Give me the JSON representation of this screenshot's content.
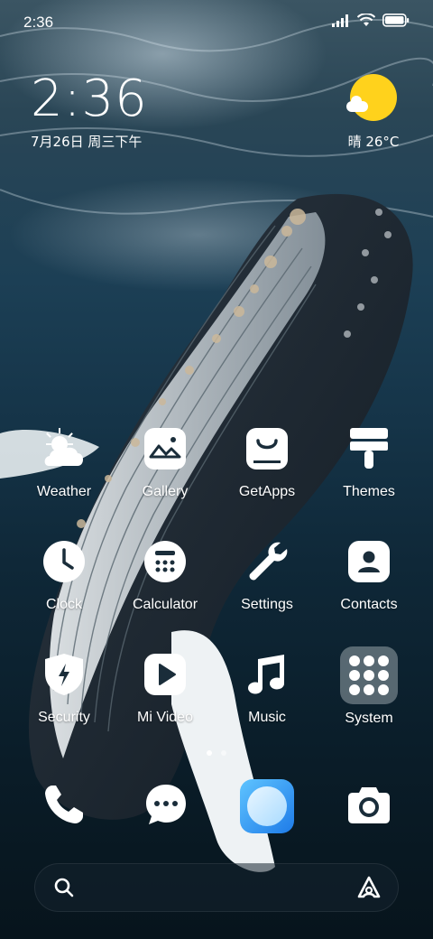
{
  "status_bar": {
    "time": "2:36",
    "icons": [
      "signal-icon",
      "wifi-icon",
      "battery-icon"
    ]
  },
  "clock_widget": {
    "time": "2:36",
    "date": "7月26日 周三下午"
  },
  "weather_widget": {
    "icon": "sunny-cloud-icon",
    "text": "晴 26°C"
  },
  "apps": [
    {
      "id": "weather",
      "label": "Weather",
      "icon": "weather-icon"
    },
    {
      "id": "gallery",
      "label": "Gallery",
      "icon": "gallery-icon"
    },
    {
      "id": "getapps",
      "label": "GetApps",
      "icon": "getapps-icon"
    },
    {
      "id": "themes",
      "label": "Themes",
      "icon": "themes-icon"
    },
    {
      "id": "clock",
      "label": "Clock",
      "icon": "clock-icon"
    },
    {
      "id": "calculator",
      "label": "Calculator",
      "icon": "calculator-icon"
    },
    {
      "id": "settings",
      "label": "Settings",
      "icon": "settings-icon"
    },
    {
      "id": "contacts",
      "label": "Contacts",
      "icon": "contacts-icon"
    },
    {
      "id": "security",
      "label": "Security",
      "icon": "security-icon"
    },
    {
      "id": "mivideo",
      "label": "Mi Video",
      "icon": "video-icon"
    },
    {
      "id": "music",
      "label": "Music",
      "icon": "music-icon"
    },
    {
      "id": "system",
      "label": "System",
      "icon": "folder-icon"
    }
  ],
  "dock": [
    {
      "id": "phone",
      "icon": "phone-icon"
    },
    {
      "id": "messages",
      "icon": "messages-icon"
    },
    {
      "id": "browser",
      "icon": "browser-icon"
    },
    {
      "id": "camera",
      "icon": "camera-icon"
    }
  ],
  "search_bar": {
    "left_icon": "search-icon",
    "right_icon": "assistant-icon"
  },
  "colors": {
    "weather_sun": "#ffd21c",
    "browser_accent": "#1e7be8"
  }
}
